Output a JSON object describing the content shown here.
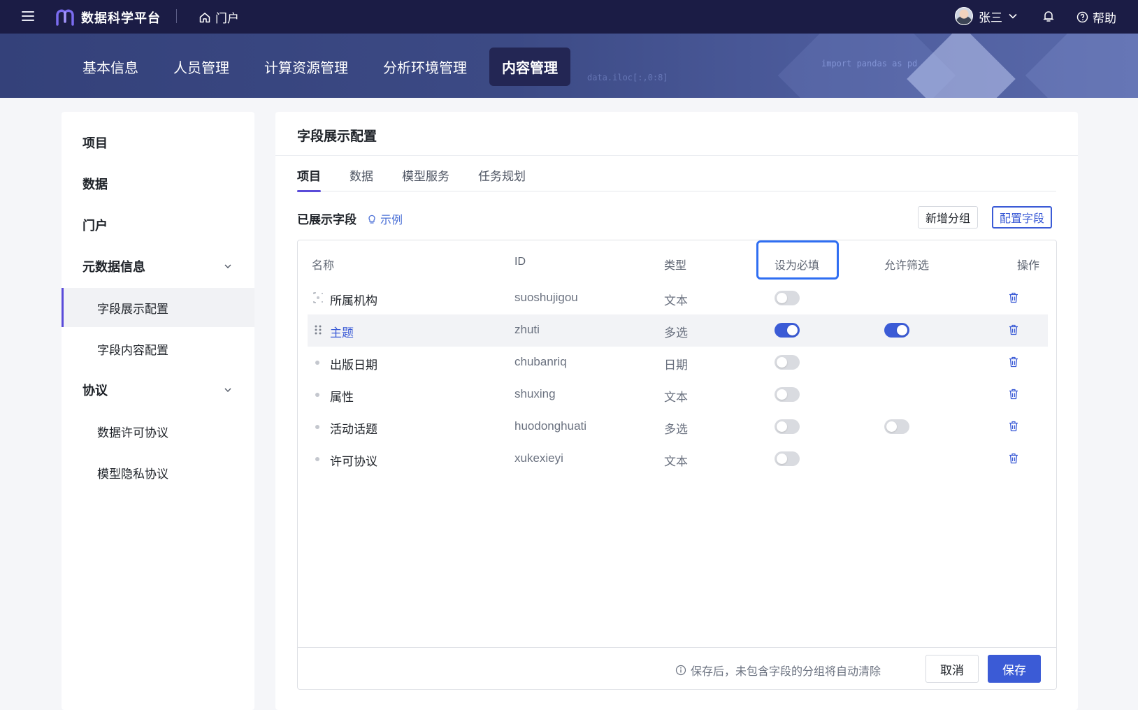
{
  "topbar": {
    "app_title": "数据科学平台",
    "portal_label": "门户",
    "user_name": "张三",
    "help_label": "帮助"
  },
  "nav": {
    "tabs": [
      {
        "label": "基本信息",
        "active": false
      },
      {
        "label": "人员管理",
        "active": false
      },
      {
        "label": "计算资源管理",
        "active": false
      },
      {
        "label": "分析环境管理",
        "active": false
      },
      {
        "label": "内容管理",
        "active": true
      }
    ],
    "banner_code": [
      "import pandas as pd",
      "data.iloc[:,0:8]"
    ]
  },
  "sidebar": {
    "items": [
      {
        "label": "项目"
      },
      {
        "label": "数据"
      },
      {
        "label": "门户"
      },
      {
        "label": "元数据信息"
      },
      {
        "label": "字段展示配置"
      },
      {
        "label": "字段内容配置"
      },
      {
        "label": "协议"
      },
      {
        "label": "数据许可协议"
      },
      {
        "label": "模型隐私协议"
      }
    ]
  },
  "main": {
    "title": "字段展示配置",
    "tabs": [
      {
        "label": "项目"
      },
      {
        "label": "数据"
      },
      {
        "label": "模型服务"
      },
      {
        "label": "任务规划"
      }
    ],
    "section_label": "已展示字段",
    "example_label": "示例",
    "add_group_label": "新增分组",
    "config_fields_label": "配置字段",
    "columns": {
      "name": "名称",
      "id": "ID",
      "type": "类型",
      "required": "设为必填",
      "filter": "允许筛选",
      "actions": "操作"
    },
    "rows": [
      {
        "name": "所属机构",
        "id": "suoshujigou",
        "type": "文本",
        "required": false,
        "filter": null
      },
      {
        "name": "主题",
        "id": "zhuti",
        "type": "多选",
        "required": true,
        "filter": true
      },
      {
        "name": "出版日期",
        "id": "chubanriq",
        "type": "日期",
        "required": false,
        "filter": null
      },
      {
        "name": "属性",
        "id": "shuxing",
        "type": "文本",
        "required": false,
        "filter": null
      },
      {
        "name": "活动话题",
        "id": "huodonghuati",
        "type": "多选",
        "required": false,
        "filter": false
      },
      {
        "name": "许可协议",
        "id": "xukexieyi",
        "type": "文本",
        "required": false,
        "filter": null
      }
    ],
    "footer_note": "保存后，未包含字段的分组将自动清除",
    "cancel_label": "取消",
    "save_label": "保存"
  },
  "colors": {
    "topbar_bg": "#1b1c45",
    "accent_blue": "#3b5bd6",
    "accent_purple": "#5a4bd9",
    "highlight_border": "#2f6ef2"
  }
}
